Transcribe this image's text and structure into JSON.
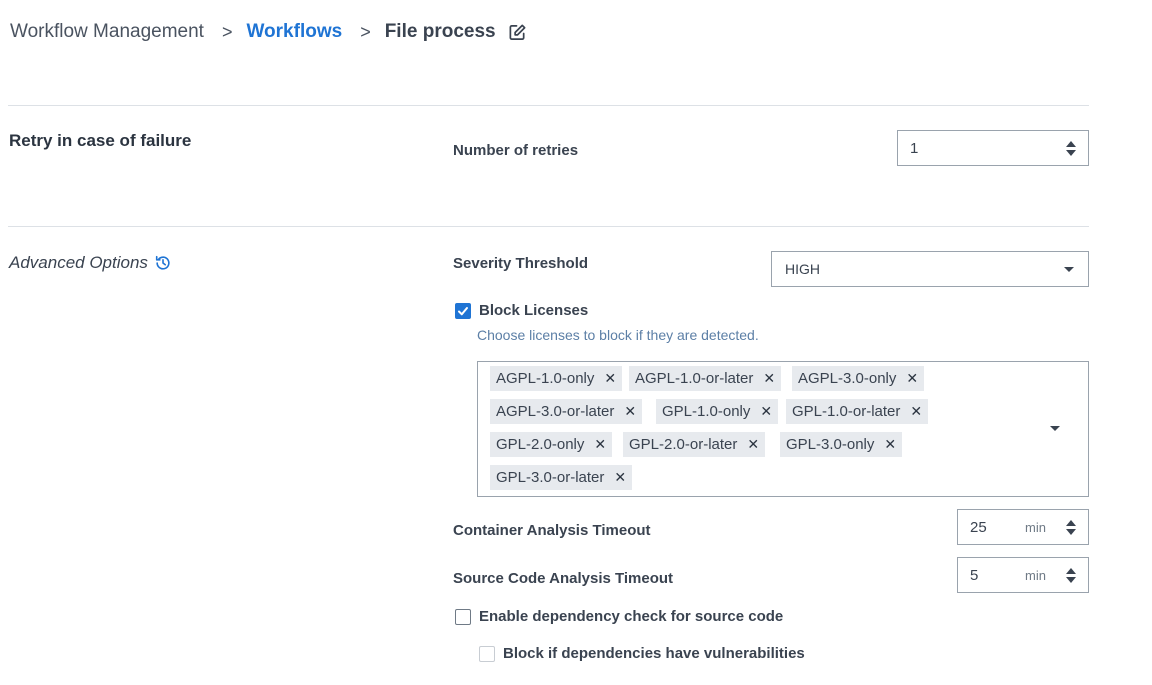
{
  "breadcrumb": {
    "root": "Workflow Management",
    "separator": ">",
    "link": "Workflows",
    "current": "File process"
  },
  "retry": {
    "section_title": "Retry in case of failure",
    "retries_label": "Number of retries",
    "retries_value": "1"
  },
  "advanced": {
    "section_title": "Advanced Options",
    "severity_label": "Severity Threshold",
    "severity_value": "HIGH",
    "block_licenses": {
      "label": "Block Licenses",
      "checked": true,
      "helper": "Choose licenses to block if they are detected.",
      "licenses": [
        "AGPL-1.0-only",
        "AGPL-1.0-or-later",
        "AGPL-3.0-only",
        "AGPL-3.0-or-later",
        "GPL-1.0-only",
        "GPL-1.0-or-later",
        "GPL-2.0-only",
        "GPL-2.0-or-later",
        "GPL-3.0-only",
        "GPL-3.0-or-later"
      ]
    },
    "container_timeout": {
      "label": "Container Analysis Timeout",
      "value": "25",
      "unit": "min"
    },
    "source_timeout": {
      "label": "Source Code Analysis Timeout",
      "value": "5",
      "unit": "min"
    },
    "dependency_check": {
      "label": "Enable dependency check for source code",
      "checked": false
    },
    "block_vulnerable": {
      "label": "Block if dependencies have vulnerabilities",
      "checked": false,
      "disabled": true
    }
  },
  "colors": {
    "accent": "#1f74d4",
    "text": "#3a4350",
    "border": "#9aa3ad",
    "tag_bg": "#e7eaee",
    "helper": "#5c7fa6"
  },
  "icons": {
    "edit": "pencil-square-icon",
    "history": "history-icon",
    "check": "checkmark-icon",
    "remove": "close-icon",
    "dropdown": "chevron-down-icon"
  }
}
